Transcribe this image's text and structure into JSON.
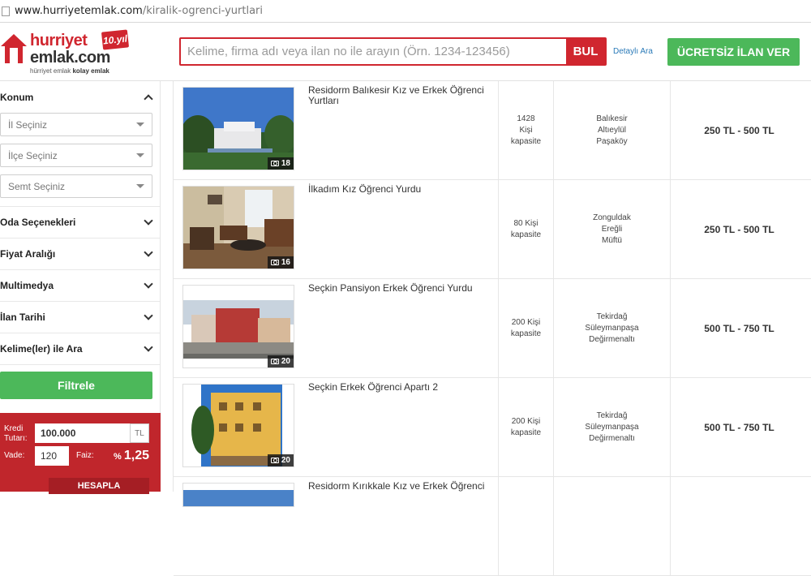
{
  "browser": {
    "url_domain": "www.hurriyetemlak.com",
    "url_path": "/kiralik-ogrenci-yurtlari"
  },
  "header": {
    "logo_line1": "hurriyet",
    "logo_line2": "emlak.com",
    "logo_badge": "10.yıl",
    "logo_tagline_plain": "hürriyet emlak",
    "logo_tagline_bold": "kolay emlak",
    "search_placeholder": "Kelime, firma adı veya ilan no ile arayın (Örn. 1234-123456)",
    "search_button": "BUL",
    "detailed_search": "Detaylı Ara",
    "post_ad_button": "ÜCRETSİZ İLAN VER"
  },
  "sidebar": {
    "location_title": "Konum",
    "city_select": "İl Seçiniz",
    "district_select": "İlçe Seçiniz",
    "neighborhood_select": "Semt Seçiniz",
    "sections": [
      {
        "label": "Oda Seçenekleri"
      },
      {
        "label": "Fiyat Aralığı"
      },
      {
        "label": "Multimedya"
      },
      {
        "label": "İlan Tarihi"
      },
      {
        "label": "Kelime(ler) ile Ara"
      }
    ],
    "filter_button": "Filtrele"
  },
  "credit": {
    "amount_label_1": "Kredi",
    "amount_label_2": "Tutarı:",
    "amount_value": "100.000",
    "currency": "TL",
    "term_label": "Vade:",
    "term_value": "120",
    "rate_label": "Faiz:",
    "rate_prefix": "%",
    "rate_value": "1,25",
    "calc_button": "HESAPLA"
  },
  "listings": [
    {
      "title": "Residorm Balıkesir Kız ve Erkek Öğrenci Yurtları",
      "photo_count": "18",
      "capacity": [
        "1428",
        "Kişi",
        "kapasite"
      ],
      "location": [
        "Balıkesir",
        "Altıeylül",
        "Paşaköy"
      ],
      "price": "250 TL - 500 TL"
    },
    {
      "title": "İlkadım Kız Öğrenci Yurdu",
      "photo_count": "16",
      "capacity": [
        "80 Kişi",
        "kapasite"
      ],
      "location": [
        "Zonguldak",
        "Ereğli",
        "Müftü"
      ],
      "price": "250 TL - 500 TL"
    },
    {
      "title": "Seçkin Pansiyon Erkek Öğrenci Yurdu",
      "photo_count": "20",
      "capacity": [
        "200 Kişi",
        "kapasite"
      ],
      "location": [
        "Tekirdağ",
        "Süleymanpaşa",
        "Değirmenaltı"
      ],
      "price": "500 TL - 750 TL"
    },
    {
      "title": "Seçkin Erkek Öğrenci Apartı 2",
      "photo_count": "20",
      "capacity": [
        "200 Kişi",
        "kapasite"
      ],
      "location": [
        "Tekirdağ",
        "Süleymanpaşa",
        "Değirmenaltı"
      ],
      "price": "500 TL - 750 TL"
    },
    {
      "title": "Residorm Kırıkkale Kız ve Erkek Öğrenci"
    }
  ]
}
